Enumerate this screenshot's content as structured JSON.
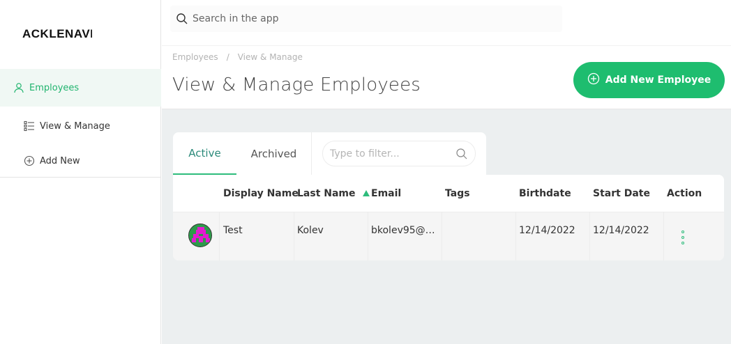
{
  "app": {
    "logo_text": "ACKLENAVENUE"
  },
  "sidebar": {
    "items": [
      {
        "label": "Employees",
        "icon": "person-icon"
      },
      {
        "label": "View & Manage",
        "icon": "list-icon"
      },
      {
        "label": "Add New",
        "icon": "plus-circle-icon"
      }
    ]
  },
  "search": {
    "placeholder": "Search in the app"
  },
  "breadcrumb": {
    "items": [
      "Employees",
      "View & Manage"
    ],
    "separator": "/"
  },
  "page": {
    "title": "View & Manage Employees"
  },
  "actions": {
    "add_employee_label": "Add New Employee"
  },
  "tabs": [
    {
      "label": "Active",
      "active": true
    },
    {
      "label": "Archived",
      "active": false
    }
  ],
  "filter": {
    "placeholder": "Type to filter..."
  },
  "table": {
    "columns": [
      "Display Name",
      "Last Name",
      "Email",
      "Tags",
      "Birthdate",
      "Start Date",
      "Action"
    ],
    "sorted_column": "Last Name",
    "sort_direction": "asc",
    "rows": [
      {
        "display_name": "Test",
        "last_name": "Kolev",
        "email": "bkolev95@g…",
        "tags": "",
        "birthdate": "12/14/2022",
        "start_date": "12/14/2022"
      }
    ]
  },
  "colors": {
    "accent": "#1ebd6f",
    "active_bg": "#f0f8f4",
    "content_bg": "#eceff0"
  }
}
